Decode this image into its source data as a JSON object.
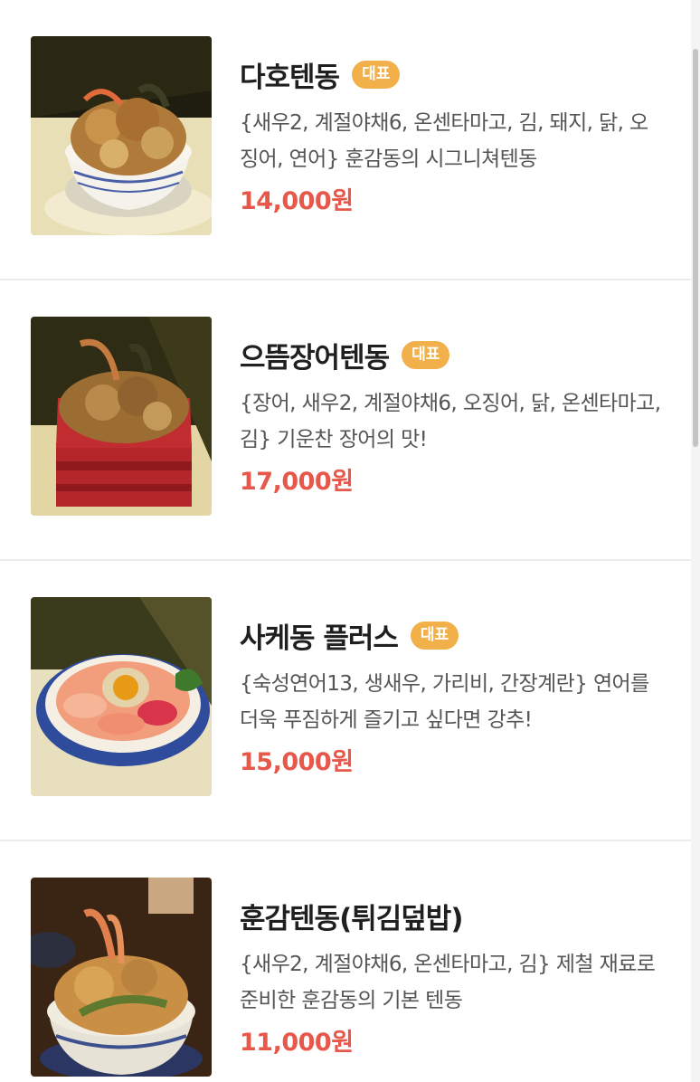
{
  "menu": [
    {
      "name": "다호텐동",
      "badge": "대표",
      "description": "{새우2, 계절야채6, 온센타마고, 김, 돼지, 닭, 오징어, 연어} 훈감동의 시그니쳐텐동",
      "price": "14,000원",
      "image": "tempura-bowl-photo"
    },
    {
      "name": "으뜸장어텐동",
      "badge": "대표",
      "description": "{장어, 새우2, 계절야채6, 오징어, 닭, 온센타마고, 김} 기운찬 장어의 맛!",
      "price": "17,000원",
      "image": "eel-tempura-box-photo"
    },
    {
      "name": "사케동 플러스",
      "badge": "대표",
      "description": "{숙성연어13, 생새우, 가리비, 간장계란} 연어를 더욱 푸짐하게 즐기고 싶다면 강추!",
      "price": "15,000원",
      "image": "salmon-bowl-photo"
    },
    {
      "name": "훈감텐동(튀김덮밥)",
      "badge": "",
      "description": "{새우2, 계절야채6, 온센타마고, 김} 제철 재료로 준비한 훈감동의 기본 텐동",
      "price": "11,000원",
      "image": "basic-tempura-bowl-photo"
    }
  ],
  "colors": {
    "badge": "#f2b04a",
    "price": "#e7574a",
    "divider": "#ececec"
  }
}
